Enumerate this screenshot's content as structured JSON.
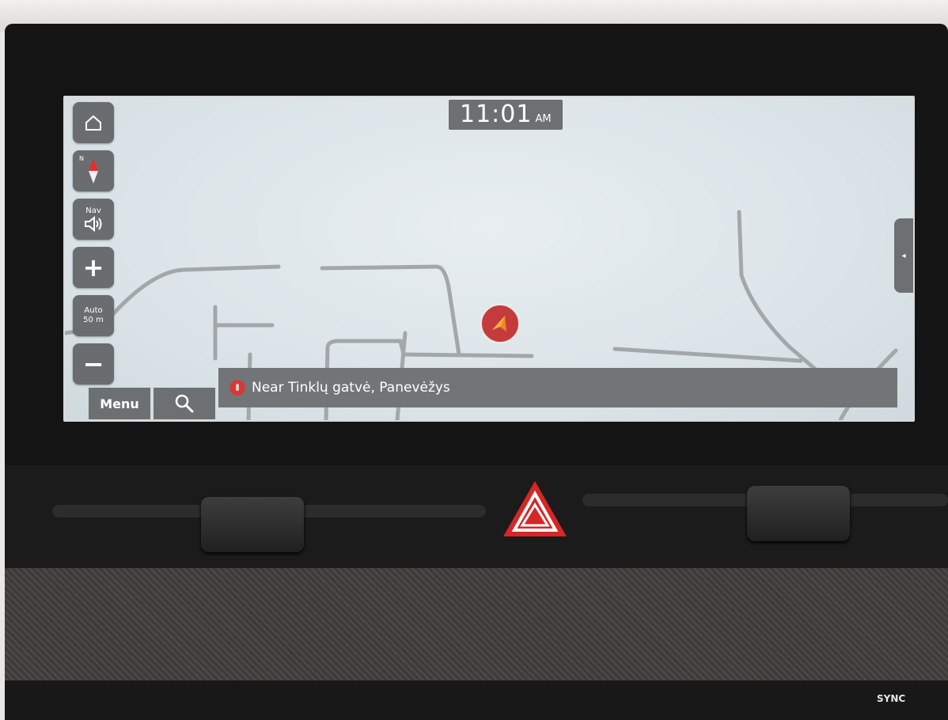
{
  "map": {
    "clock_time": "11:01",
    "clock_ampm": "AM",
    "nav_label": "Nav",
    "zoom_mode_line1": "Auto",
    "zoom_mode_line2": "50 m",
    "menu_label": "Menu",
    "location_text": "Near Tinklų gatvė, Panevėžys",
    "compass_n": "N"
  },
  "dashboard": {
    "sync_label": "SYNC"
  },
  "icons": {
    "home": "home-icon",
    "compass": "compass-icon",
    "volume": "speaker-icon",
    "zoom_in": "plus-icon",
    "zoom_out": "minus-icon",
    "search": "search-icon",
    "position": "location-pin-icon",
    "car": "vehicle-arrow-icon",
    "hazard": "hazard-triangle-icon",
    "side_panel": "chevron-left-icon"
  },
  "colors": {
    "button_bg": "#6d7073",
    "map_bg": "#dde6ea",
    "road": "#a3a7aa",
    "car_marker": "#c43b3b",
    "hazard": "#d62626"
  }
}
